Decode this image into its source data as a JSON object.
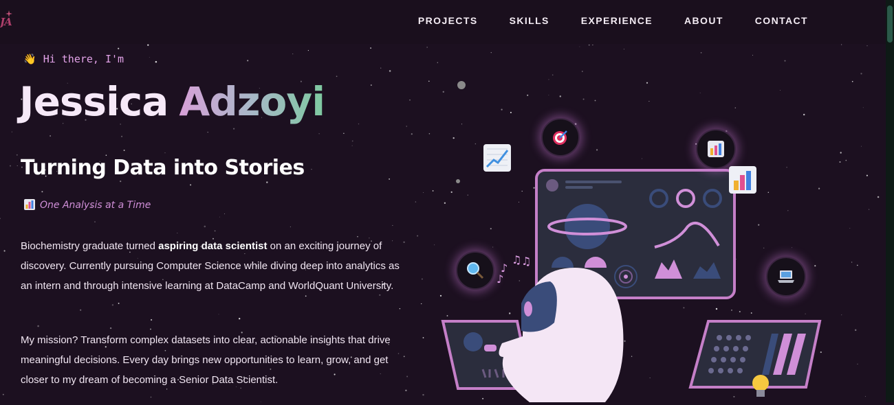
{
  "nav": {
    "logo_text": "JA",
    "links": [
      "PROJECTS",
      "SKILLS",
      "EXPERIENCE",
      "ABOUT",
      "CONTACT"
    ]
  },
  "hero": {
    "greeting": "Hi there, I'm",
    "first_name": "Jessica",
    "last_name": "Adzoyi",
    "tagline": "Turning Data into Stories",
    "subtagline": "One Analysis at a Time",
    "bio_1_pre": "Biochemistry graduate turned ",
    "bio_1_bold": "aspiring data scientist",
    "bio_1_post": " on an exciting journey of discovery. Currently pursuing Computer Science while diving deep into analytics as an intern and through intensive learning at DataCamp and WorldQuant University.",
    "bio_2": "My mission? Transform complex datasets into clear, actionable insights that drive meaningful decisions. Every day brings new opportunities to learn, grow, and get closer to my dream of becoming a Senior Data Scientist."
  },
  "icons": {
    "greeting": "waving-hand-icon",
    "subtagline": "bar-chart-icon",
    "orbit": [
      "target-icon",
      "bar-chart-icon",
      "magnifier-icon",
      "laptop-icon"
    ],
    "floating": [
      "trend-chart-icon",
      "bar-chart-icon",
      "music-notes-icon",
      "lightbulb-icon"
    ]
  },
  "colors": {
    "background": "#1c1020",
    "accent_pink": "#d08fd8",
    "panel": "#2b2d3d",
    "panel_border": "#c57fc8",
    "name_gradient": [
      "#d8a0d8",
      "#a8b8c8",
      "#7ec9a0"
    ]
  }
}
